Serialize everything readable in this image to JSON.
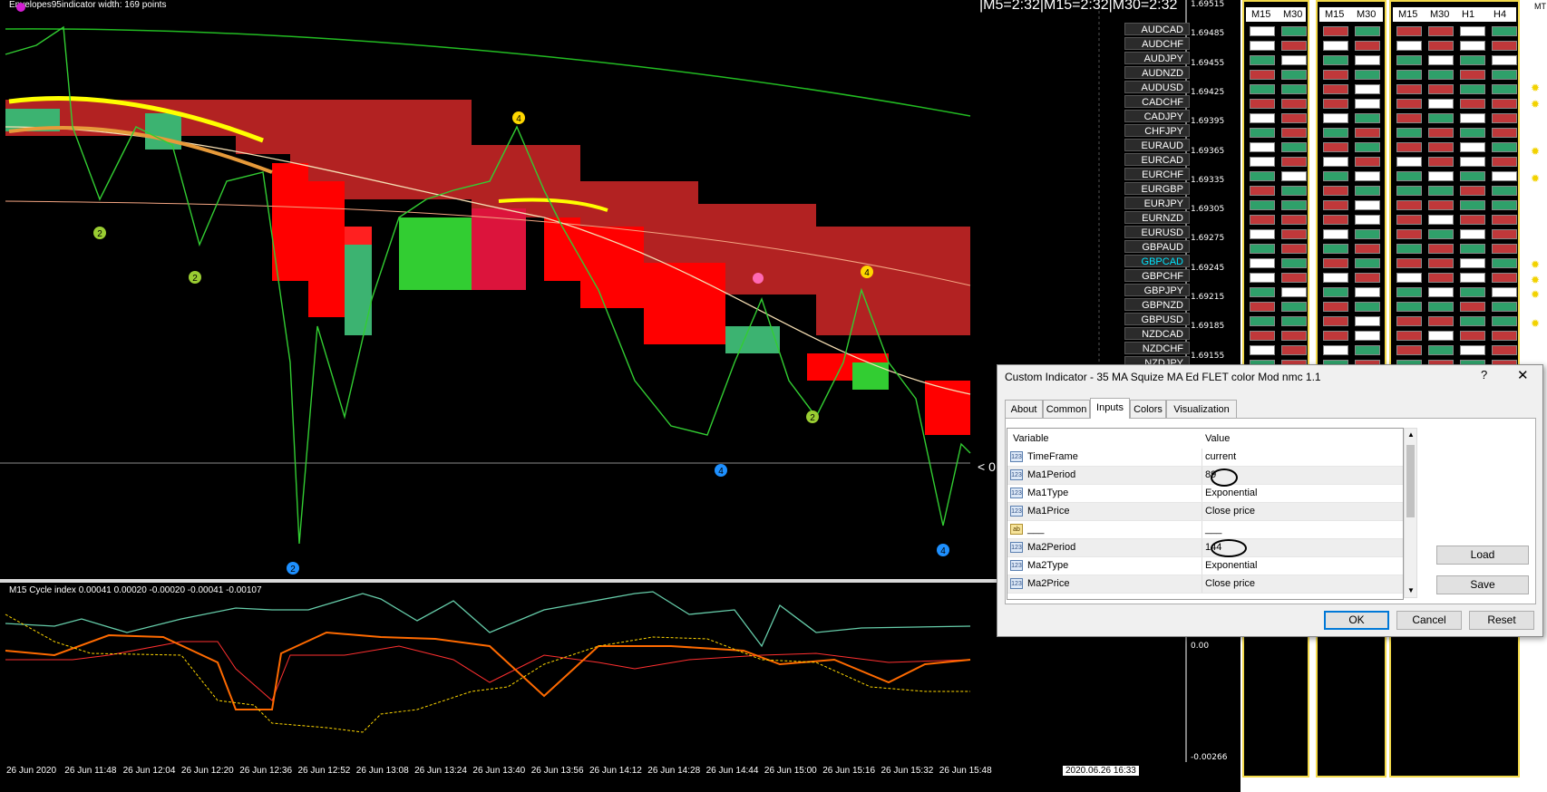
{
  "chart": {
    "indicator_label": "Envelopes95indicator width: 169 points",
    "top_timeframes": "|M5=2:32|M15=2:32|M30=2:32",
    "price_labels": [
      "1.69515",
      "1.69485",
      "1.69455",
      "1.69425",
      "1.69395",
      "1.69365",
      "1.69335",
      "1.69305",
      "1.69275",
      "1.69245",
      "1.69215",
      "1.69185",
      "1.69155"
    ],
    "cycle_label": "M15 Cycle index 0.00041 0.00020 -0.00020 -0.00041 -0.00107",
    "sub_axis": [
      "0.00",
      "-0.00266"
    ],
    "current_price_marker": "< 0",
    "time_labels": [
      "26 Jun 2020",
      "26 Jun 11:48",
      "26 Jun 12:04",
      "26 Jun 12:20",
      "26 Jun 12:36",
      "26 Jun 12:52",
      "26 Jun 13:08",
      "26 Jun 13:24",
      "26 Jun 13:40",
      "26 Jun 13:56",
      "26 Jun 14:12",
      "26 Jun 14:28",
      "26 Jun 14:44",
      "26 Jun 15:00",
      "26 Jun 15:16",
      "26 Jun 15:32",
      "26 Jun 15:48"
    ],
    "crosshair_time": "2020.06.26 16:33",
    "wave_markers": [
      "2",
      "2",
      "4",
      "2",
      "4",
      "2",
      "4",
      "4",
      "4"
    ]
  },
  "symbols": [
    "AUDCAD",
    "AUDCHF",
    "AUDJPY",
    "AUDNZD",
    "AUDUSD",
    "CADCHF",
    "CADJPY",
    "CHFJPY",
    "EURAUD",
    "EURCAD",
    "EURCHF",
    "EURGBP",
    "EURJPY",
    "EURNZD",
    "EURUSD",
    "GBPAUD",
    "GBPCAD",
    "GBPCHF",
    "GBPJPY",
    "GBPNZD",
    "GBPUSD",
    "NZDCAD",
    "NZDCHF",
    "NZDJPY"
  ],
  "active_symbol": "GBPCAD",
  "panels": [
    {
      "headers": [
        "M15",
        "M30"
      ]
    },
    {
      "headers": [
        "M15",
        "M30"
      ]
    },
    {
      "headers": [
        "M15",
        "M30",
        "H1",
        "H4"
      ]
    }
  ],
  "panel_side_label": "MT",
  "colors": {
    "bull": "#32cd32",
    "bear": "#ff0000",
    "dark_bear": "#b22222",
    "accent_yellow": "#ffff00"
  },
  "dialog": {
    "title": "Custom Indicator - 35 MA Squize MA Ed FLET color Mod nmc 1.1",
    "help": "?",
    "close": "✕",
    "tabs": [
      "About",
      "Common",
      "Inputs",
      "Colors",
      "Visualization"
    ],
    "active_tab": "Inputs",
    "columns": [
      "Variable",
      "Value"
    ],
    "rows": [
      {
        "icon": "123",
        "name": "TimeFrame",
        "value": "current"
      },
      {
        "icon": "123",
        "name": "Ma1Period",
        "value": "89"
      },
      {
        "icon": "123",
        "name": "Ma1Type",
        "value": "Exponential"
      },
      {
        "icon": "123",
        "name": "Ma1Price",
        "value": "Close price"
      },
      {
        "icon": "ab",
        "name": "___",
        "value": "___"
      },
      {
        "icon": "123",
        "name": "Ma2Period",
        "value": "144"
      },
      {
        "icon": "123",
        "name": "Ma2Type",
        "value": "Exponential"
      },
      {
        "icon": "123",
        "name": "Ma2Price",
        "value": "Close price"
      }
    ],
    "load": "Load",
    "save": "Save",
    "ok": "OK",
    "cancel": "Cancel",
    "reset": "Reset"
  }
}
